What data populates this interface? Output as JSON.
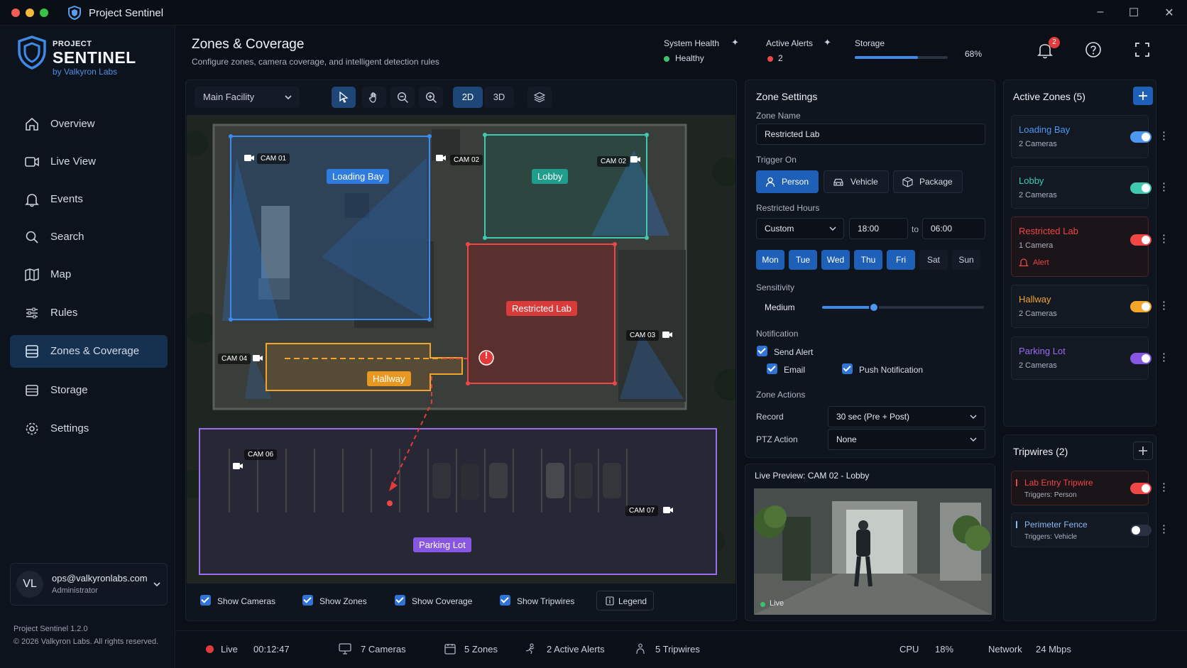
{
  "window": {
    "title": "Project Sentinel",
    "minimize": "–",
    "maximize": "☐",
    "close": "✕"
  },
  "brand": {
    "sub": "PROJECT",
    "name": "SENTINEL",
    "by": "by Valkyron Labs"
  },
  "nav": [
    {
      "label": "Overview",
      "icon": "home-icon"
    },
    {
      "label": "Live View",
      "icon": "video-icon"
    },
    {
      "label": "Events",
      "icon": "bell-icon"
    },
    {
      "label": "Search",
      "icon": "search-icon"
    },
    {
      "label": "Map",
      "icon": "map-icon"
    },
    {
      "label": "Rules",
      "icon": "sliders-icon"
    },
    {
      "label": "Zones & Coverage",
      "icon": "layers-icon",
      "active": true
    },
    {
      "label": "Storage",
      "icon": "storage-icon"
    },
    {
      "label": "Settings",
      "icon": "gear-icon"
    }
  ],
  "user": {
    "initials": "VL",
    "email": "ops@valkyronlabs.com",
    "role": "Administrator"
  },
  "footer": {
    "version": "Project Sentinel 1.2.0",
    "copyright": "© 2026 Valkyron Labs. All rights reserved."
  },
  "header": {
    "title": "Zones & Coverage",
    "subtitle": "Configure zones, camera coverage, and intelligent detection rules",
    "system_health_label": "System Health",
    "system_health_value": "Healthy",
    "active_alerts_label": "Active Alerts",
    "active_alerts_value": "2",
    "storage_label": "Storage",
    "storage_value": "68%",
    "storage_fraction": 0.68,
    "notification_count": "2"
  },
  "map_toolbar": {
    "facility": "Main Facility",
    "mode_2d": "2D",
    "mode_3d": "3D"
  },
  "map": {
    "zones": {
      "loading_bay": "Loading Bay",
      "lobby": "Lobby",
      "restricted_lab": "Restricted Lab",
      "hallway": "Hallway",
      "parking_lot": "Parking Lot"
    },
    "cameras": {
      "cam01": "CAM 01",
      "cam02a": "CAM 02",
      "cam02b": "CAM 02",
      "cam03": "CAM 03",
      "cam04": "CAM 04",
      "cam06": "CAM 06",
      "cam07": "CAM 07"
    },
    "alert_glyph": "!"
  },
  "map_options": {
    "show_cameras": "Show Cameras",
    "show_zones": "Show Zones",
    "show_coverage": "Show Coverage",
    "show_tripwires": "Show Tripwires",
    "legend": "Legend"
  },
  "zone_settings": {
    "title": "Zone Settings",
    "zone_name_label": "Zone Name",
    "zone_name": "Restricted Lab",
    "trigger_label": "Trigger On",
    "triggers": {
      "person": "Person",
      "vehicle": "Vehicle",
      "package": "Package"
    },
    "hours_label": "Restricted Hours",
    "hours_mode": "Custom",
    "hours_from": "18:00",
    "hours_to_label": "to",
    "hours_to": "06:00",
    "days": [
      "Mon",
      "Tue",
      "Wed",
      "Thu",
      "Fri",
      "Sat",
      "Sun"
    ],
    "sensitivity_label": "Sensitivity",
    "sensitivity_value": "Medium",
    "sensitivity_fraction": 0.32,
    "notification_label": "Notification",
    "send_alert": "Send Alert",
    "email": "Email",
    "push": "Push Notification",
    "actions_label": "Zone Actions",
    "record_label": "Record",
    "record_value": "30 sec (Pre + Post)",
    "ptz_label": "PTZ Action",
    "ptz_value": "None"
  },
  "preview": {
    "title": "Live Preview: CAM 02 - Lobby",
    "live": "Live"
  },
  "active_zones": {
    "title": "Active Zones (5)",
    "items": [
      {
        "name": "Loading Bay",
        "cams": "2 Cameras",
        "color": "#4d97f0"
      },
      {
        "name": "Lobby",
        "cams": "2 Cameras",
        "color": "#3fc9b0"
      },
      {
        "name": "Restricted Lab",
        "cams": "1 Camera",
        "color": "#ef4646",
        "alert": "Alert"
      },
      {
        "name": "Hallway",
        "cams": "2 Cameras",
        "color": "#f2a42b"
      },
      {
        "name": "Parking Lot",
        "cams": "2 Cameras",
        "color": "#9a6cf0"
      }
    ]
  },
  "tripwires": {
    "title": "Tripwires (2)",
    "items": [
      {
        "name": "Lab Entry Tripwire",
        "trigger": "Triggers: Person",
        "color": "#ef4646",
        "on": true
      },
      {
        "name": "Perimeter Fence",
        "trigger": "Triggers: Vehicle",
        "color": "#8ab8f2",
        "on": false
      }
    ]
  },
  "statusbar": {
    "live": "Live",
    "time": "00:12:47",
    "cameras": "7 Cameras",
    "zones": "5 Zones",
    "alerts": "2 Active Alerts",
    "tripwires": "5 Tripwires",
    "cpu_label": "CPU",
    "cpu_value": "18%",
    "network_label": "Network",
    "network_value": "24 Mbps"
  }
}
